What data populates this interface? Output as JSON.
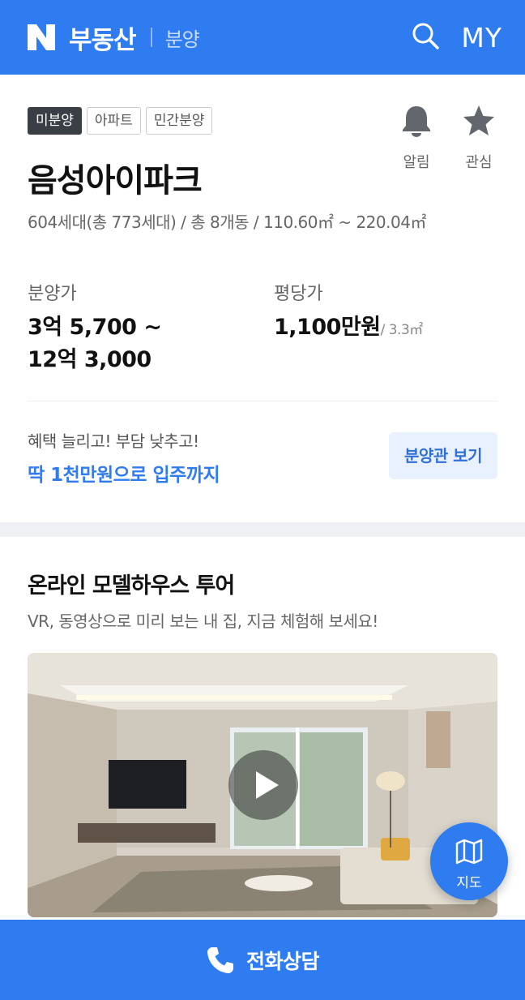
{
  "header": {
    "brand": "부동산",
    "subtitle": "분양",
    "my_label": "MY"
  },
  "property": {
    "tags": [
      "미분양",
      "아파트",
      "민간분양"
    ],
    "name": "음성아이파크",
    "summary": "604세대(총 773세대) / 총 8개동 / 110.60㎡ ~ 220.04㎡",
    "actions": {
      "alert": "알림",
      "favorite": "관심"
    },
    "sale_price_label": "분양가",
    "sale_price_line1": "3억 5,700 ~",
    "sale_price_line2": "12억 3,000",
    "per_pyeong_label": "평당가",
    "per_pyeong_value": "1,100만원",
    "per_pyeong_unit": "/ 3.3㎡"
  },
  "promo": {
    "line1": "혜택 늘리고! 부담 낮추고!",
    "line2": "딱 1천만원으로 입주까지",
    "button": "분양관 보기"
  },
  "tour": {
    "title": "온라인 모델하우스 투어",
    "description": "VR, 동영상으로 미리 보는 내 집, 지금 체험해 보세요!",
    "map_label": "지도"
  },
  "bottom_bar": {
    "call_label": "전화상담"
  },
  "colors": {
    "primary": "#2f7bf0",
    "tag_dark": "#3a3f45",
    "promo_text": "#2f7bf0"
  }
}
